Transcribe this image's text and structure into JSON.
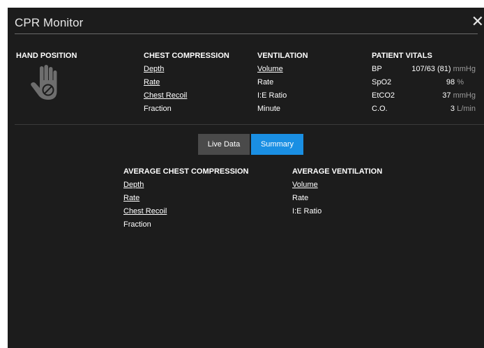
{
  "window": {
    "title": "CPR Monitor",
    "close_glyph": "✕"
  },
  "hand_position": {
    "label": "HAND POSITION",
    "icon": "hand-blocked-icon"
  },
  "chest_compression": {
    "label": "CHEST COMPRESSION",
    "items": [
      "Depth",
      "Rate",
      "Chest Recoil",
      "Fraction"
    ]
  },
  "ventilation": {
    "label": "VENTILATION",
    "items": [
      "Volume",
      "Rate",
      "I:E Ratio",
      "Minute"
    ]
  },
  "patient_vitals": {
    "label": "PATIENT VITALS",
    "rows": [
      {
        "name": "BP",
        "value": "107/63 (81)",
        "unit": "mmHg"
      },
      {
        "name": "SpO2",
        "value": "98",
        "unit": "%"
      },
      {
        "name": "EtCO2",
        "value": "37",
        "unit": "mmHg"
      },
      {
        "name": "C.O.",
        "value": "3",
        "unit": "L/min"
      }
    ]
  },
  "tabs": {
    "live": "Live Data",
    "summary": "Summary",
    "active": "summary"
  },
  "summary": {
    "avg_compression": {
      "label": "AVERAGE CHEST COMPRESSION",
      "items": [
        "Depth",
        "Rate",
        "Chest Recoil",
        "Fraction"
      ]
    },
    "avg_ventilation": {
      "label": "AVERAGE VENTILATION",
      "items": [
        "Volume",
        "Rate",
        "I:E Ratio"
      ]
    }
  },
  "colors": {
    "background": "#1c1c1c",
    "accent": "#1a8fe3",
    "unit": "#9a9a9a",
    "tab_inactive": "#4a4a4a"
  }
}
